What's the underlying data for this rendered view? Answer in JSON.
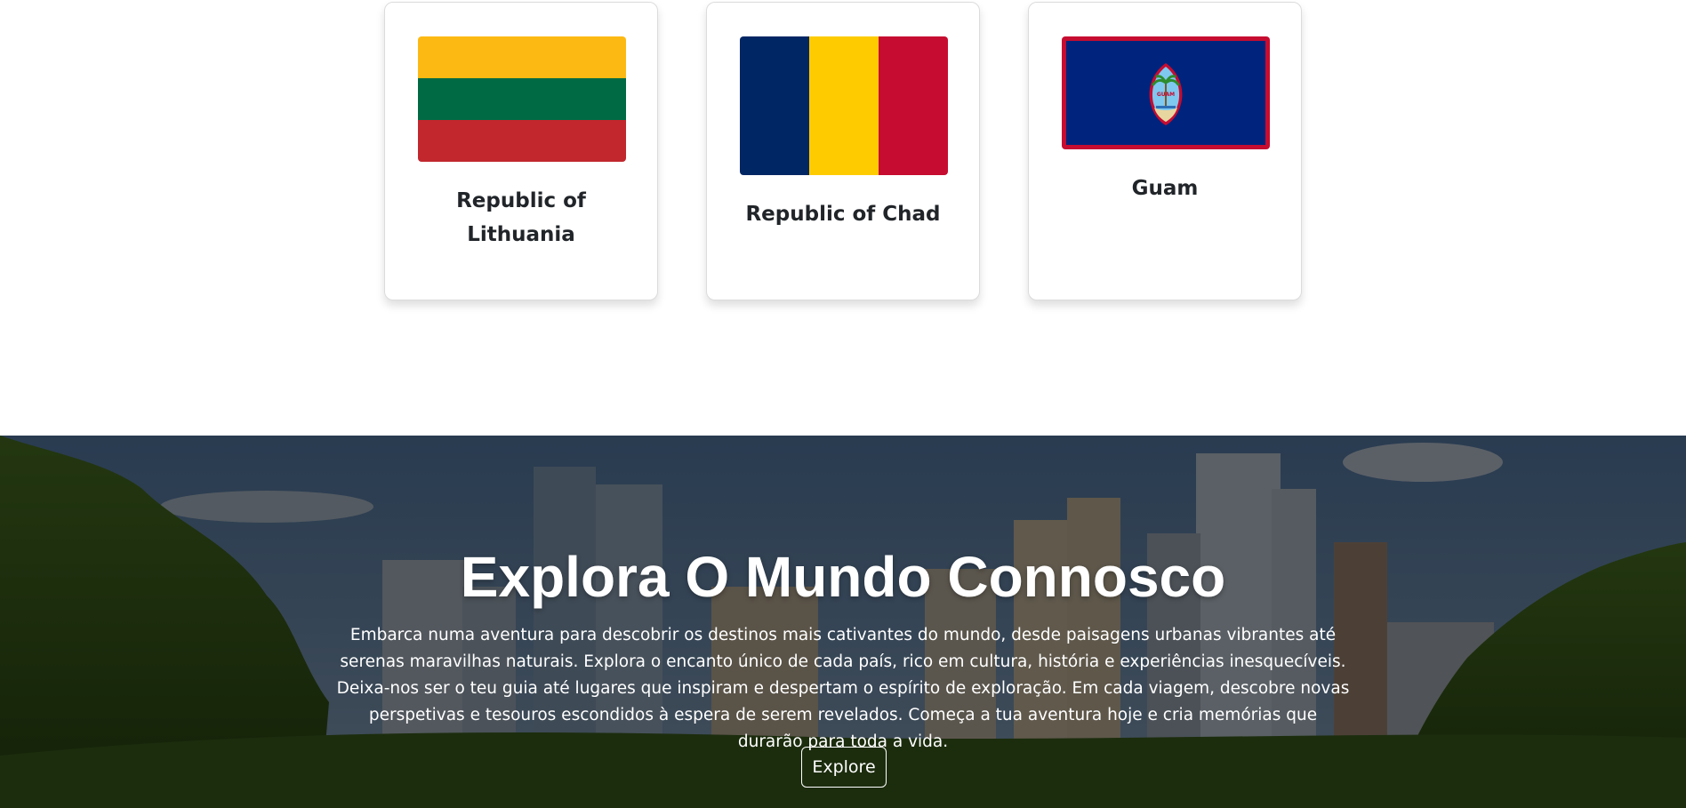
{
  "countries": [
    {
      "name": "Republic of Lithuania",
      "flag": "lithuania-flag",
      "colors": [
        "#FDB913",
        "#006A44",
        "#C1272D"
      ]
    },
    {
      "name": "Republic of Chad",
      "flag": "chad-flag",
      "colors": [
        "#002664",
        "#FECB00",
        "#C60C30"
      ]
    },
    {
      "name": "Guam",
      "flag": "guam-flag",
      "colors": [
        "#00247D",
        "#C60C30"
      ],
      "seal_text": "GUAM"
    }
  ],
  "hero": {
    "title": "Explora O Mundo Connosco",
    "text": "Embarca numa aventura para descobrir os destinos mais cativantes do mundo, desde paisagens urbanas vibrantes até serenas maravilhas naturais. Explora o encanto único de cada país, rico em cultura, história e experiências inesquecíveis. Deixa-nos ser o teu guia até lugares que inspiram e despertam o espírito de exploração. Em cada viagem, descobre novas perspetivas e tesouros escondidos à espera de serem revelados. Começa a tua aventura hoje e cria memórias que durarão para toda a vida.",
    "button_label": "Explore",
    "background": "city-skyline-park-photo"
  }
}
